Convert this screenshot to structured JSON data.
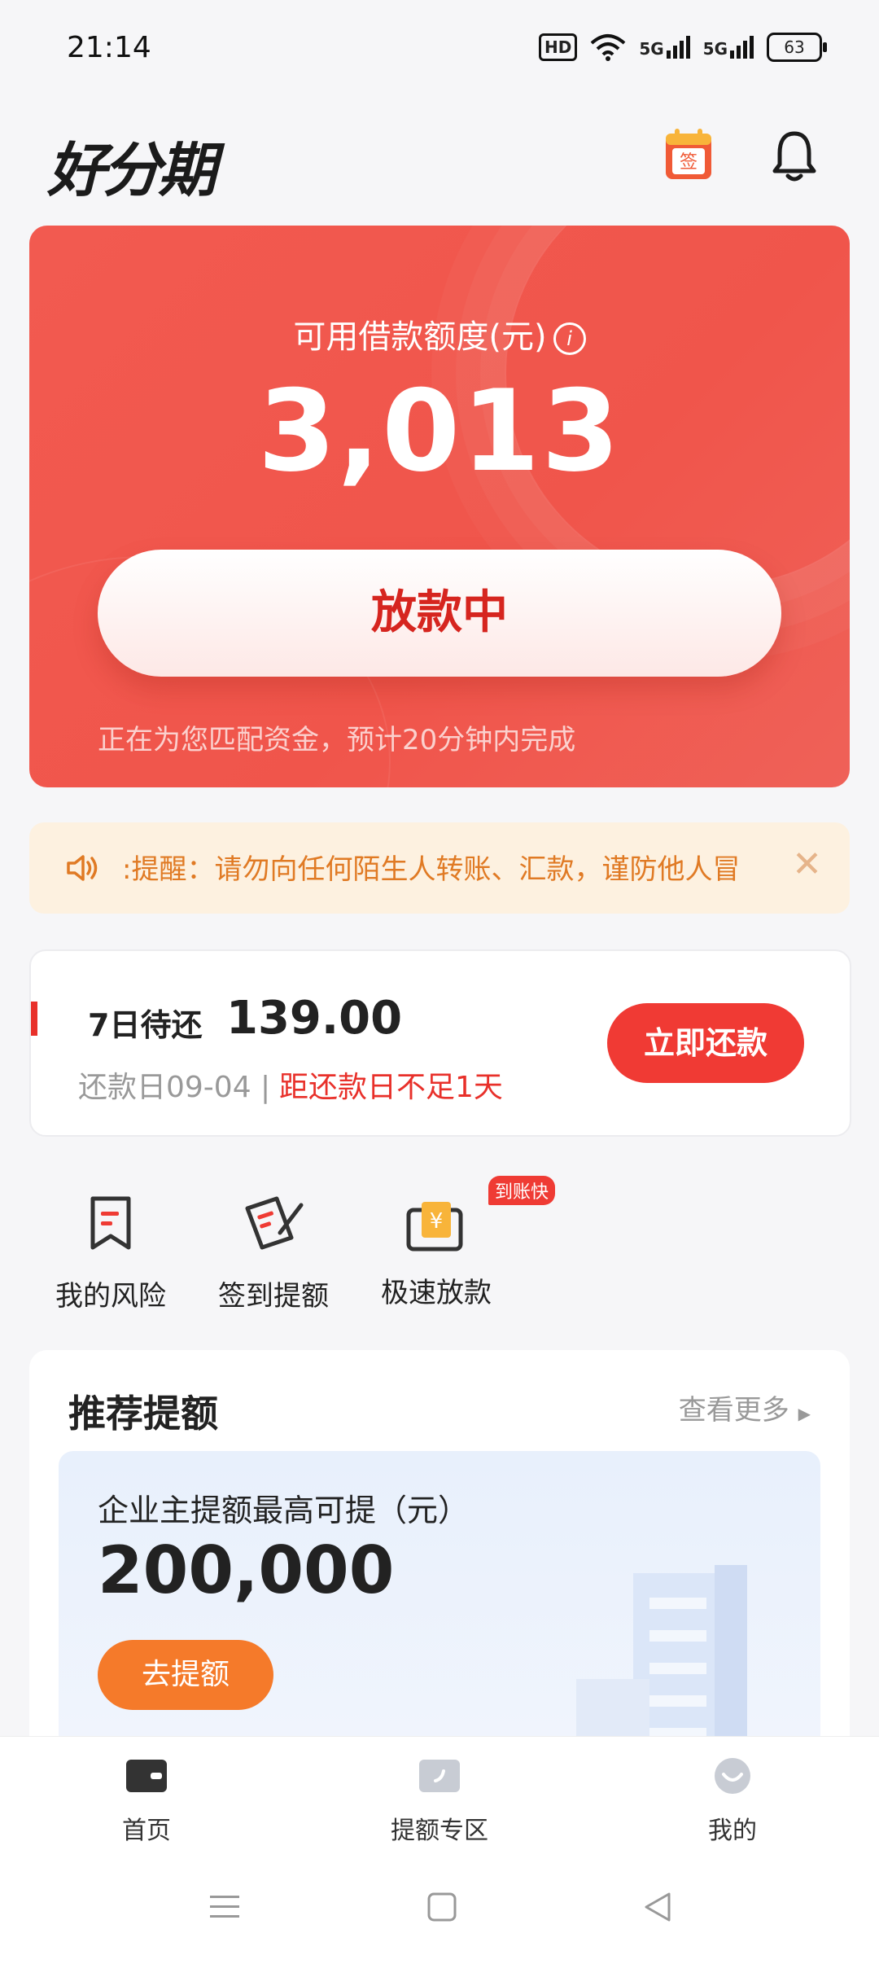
{
  "status_bar": {
    "time": "21:14",
    "hd": "HD",
    "net1": "5G",
    "net2": "5G",
    "battery": "63"
  },
  "header": {
    "logo": "好分期"
  },
  "credit_card": {
    "label": "可用借款额度(元)",
    "amount": "3,013",
    "button_label": "放款中",
    "note": "正在为您匹配资金，预计20分钟内完成"
  },
  "notice": {
    "text": ":提醒：请勿向任何陌生人转账、汇款，谨防他人冒"
  },
  "repayment": {
    "label": "7日待还",
    "amount": "139.00",
    "date_text": "还款日09-04 |",
    "due_text": "距还款日不足1天",
    "button_label": "立即还款"
  },
  "quick_actions": [
    {
      "label": "我的风险"
    },
    {
      "label": "签到提额"
    },
    {
      "label": "极速放款",
      "badge": "到账快"
    }
  ],
  "recommend": {
    "title": "推荐提额",
    "more_label": "查看更多",
    "subtitle": "企业主提额最高可提（元）",
    "amount": "200,000",
    "button_label": "去提额"
  },
  "tabs": [
    {
      "label": "首页"
    },
    {
      "label": "提额专区"
    },
    {
      "label": "我的"
    }
  ],
  "colors": {
    "brand_red": "#f0554b",
    "accent_orange": "#f57a2a",
    "due_red": "#e8302a"
  }
}
